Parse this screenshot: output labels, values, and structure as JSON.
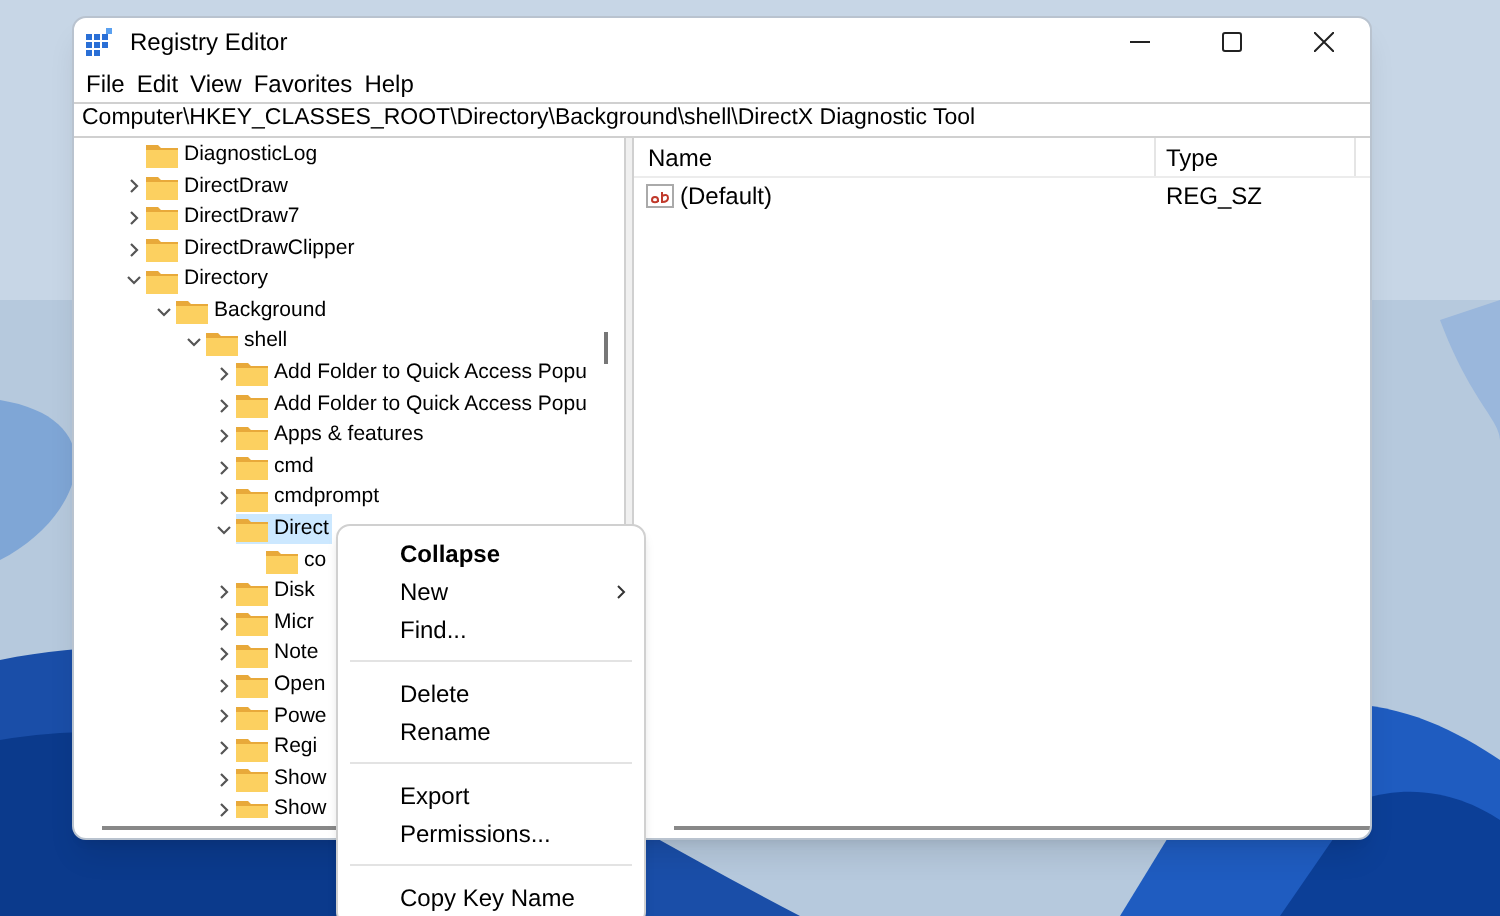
{
  "window": {
    "title": "Registry Editor"
  },
  "menu": [
    "File",
    "Edit",
    "View",
    "Favorites",
    "Help"
  ],
  "address": "Computer\\HKEY_CLASSES_ROOT\\Directory\\Background\\shell\\DirectX Diagnostic Tool",
  "tree": [
    {
      "label": "DiagnosticLog",
      "expandable": false,
      "selected": false
    },
    {
      "label": "DirectDraw",
      "expandable": true,
      "expanded": false,
      "selected": false
    },
    {
      "label": "DirectDraw7",
      "expandable": true,
      "expanded": false,
      "selected": false
    },
    {
      "label": "DirectDrawClipper",
      "expandable": true,
      "expanded": false,
      "selected": false
    },
    {
      "label": "Directory",
      "expandable": true,
      "expanded": true,
      "selected": false,
      "children": [
        {
          "label": "Background",
          "expandable": true,
          "expanded": true,
          "selected": false,
          "children": [
            {
              "label": "shell",
              "expandable": true,
              "expanded": true,
              "selected": false,
              "children": [
                {
                  "label": "Add Folder to Quick Access Popu",
                  "expandable": true,
                  "expanded": false,
                  "selected": false
                },
                {
                  "label": "Add Folder to Quick Access Popu",
                  "expandable": true,
                  "expanded": false,
                  "selected": false
                },
                {
                  "label": "Apps & features",
                  "expandable": true,
                  "expanded": false,
                  "selected": false
                },
                {
                  "label": "cmd",
                  "expandable": true,
                  "expanded": false,
                  "selected": false
                },
                {
                  "label": "cmdprompt",
                  "expandable": true,
                  "expanded": false,
                  "selected": false
                },
                {
                  "label": "Direct",
                  "expandable": true,
                  "expanded": true,
                  "selected": true,
                  "children": [
                    {
                      "label": "co",
                      "expandable": false,
                      "selected": false
                    }
                  ]
                },
                {
                  "label": "Disk",
                  "expandable": true,
                  "expanded": false,
                  "selected": false
                },
                {
                  "label": "Micr",
                  "expandable": true,
                  "expanded": false,
                  "selected": false
                },
                {
                  "label": "Note",
                  "expandable": true,
                  "expanded": false,
                  "selected": false
                },
                {
                  "label": "Open",
                  "expandable": true,
                  "expanded": false,
                  "selected": false
                },
                {
                  "label": "Powe",
                  "expandable": true,
                  "expanded": false,
                  "selected": false
                },
                {
                  "label": "Regi",
                  "expandable": true,
                  "expanded": false,
                  "selected": false
                },
                {
                  "label": "Show",
                  "expandable": true,
                  "expanded": false,
                  "selected": false
                },
                {
                  "label": "Show",
                  "expandable": true,
                  "expanded": false,
                  "selected": false
                }
              ]
            }
          ]
        }
      ]
    }
  ],
  "values": {
    "columns": [
      "Name",
      "Type"
    ],
    "rows": [
      {
        "name": "(Default)",
        "type": "REG_SZ"
      }
    ]
  },
  "context_menu": [
    {
      "kind": "item",
      "label": "Collapse",
      "default": true,
      "submenu": false
    },
    {
      "kind": "item",
      "label": "New",
      "default": false,
      "submenu": true
    },
    {
      "kind": "item",
      "label": "Find...",
      "default": false,
      "submenu": false
    },
    {
      "kind": "separator"
    },
    {
      "kind": "item",
      "label": "Delete",
      "default": false,
      "submenu": false
    },
    {
      "kind": "item",
      "label": "Rename",
      "default": false,
      "submenu": false
    },
    {
      "kind": "separator"
    },
    {
      "kind": "item",
      "label": "Export",
      "default": false,
      "submenu": false
    },
    {
      "kind": "item",
      "label": "Permissions...",
      "default": false,
      "submenu": false
    },
    {
      "kind": "separator"
    },
    {
      "kind": "item",
      "label": "Copy Key Name",
      "default": false,
      "submenu": false
    }
  ]
}
